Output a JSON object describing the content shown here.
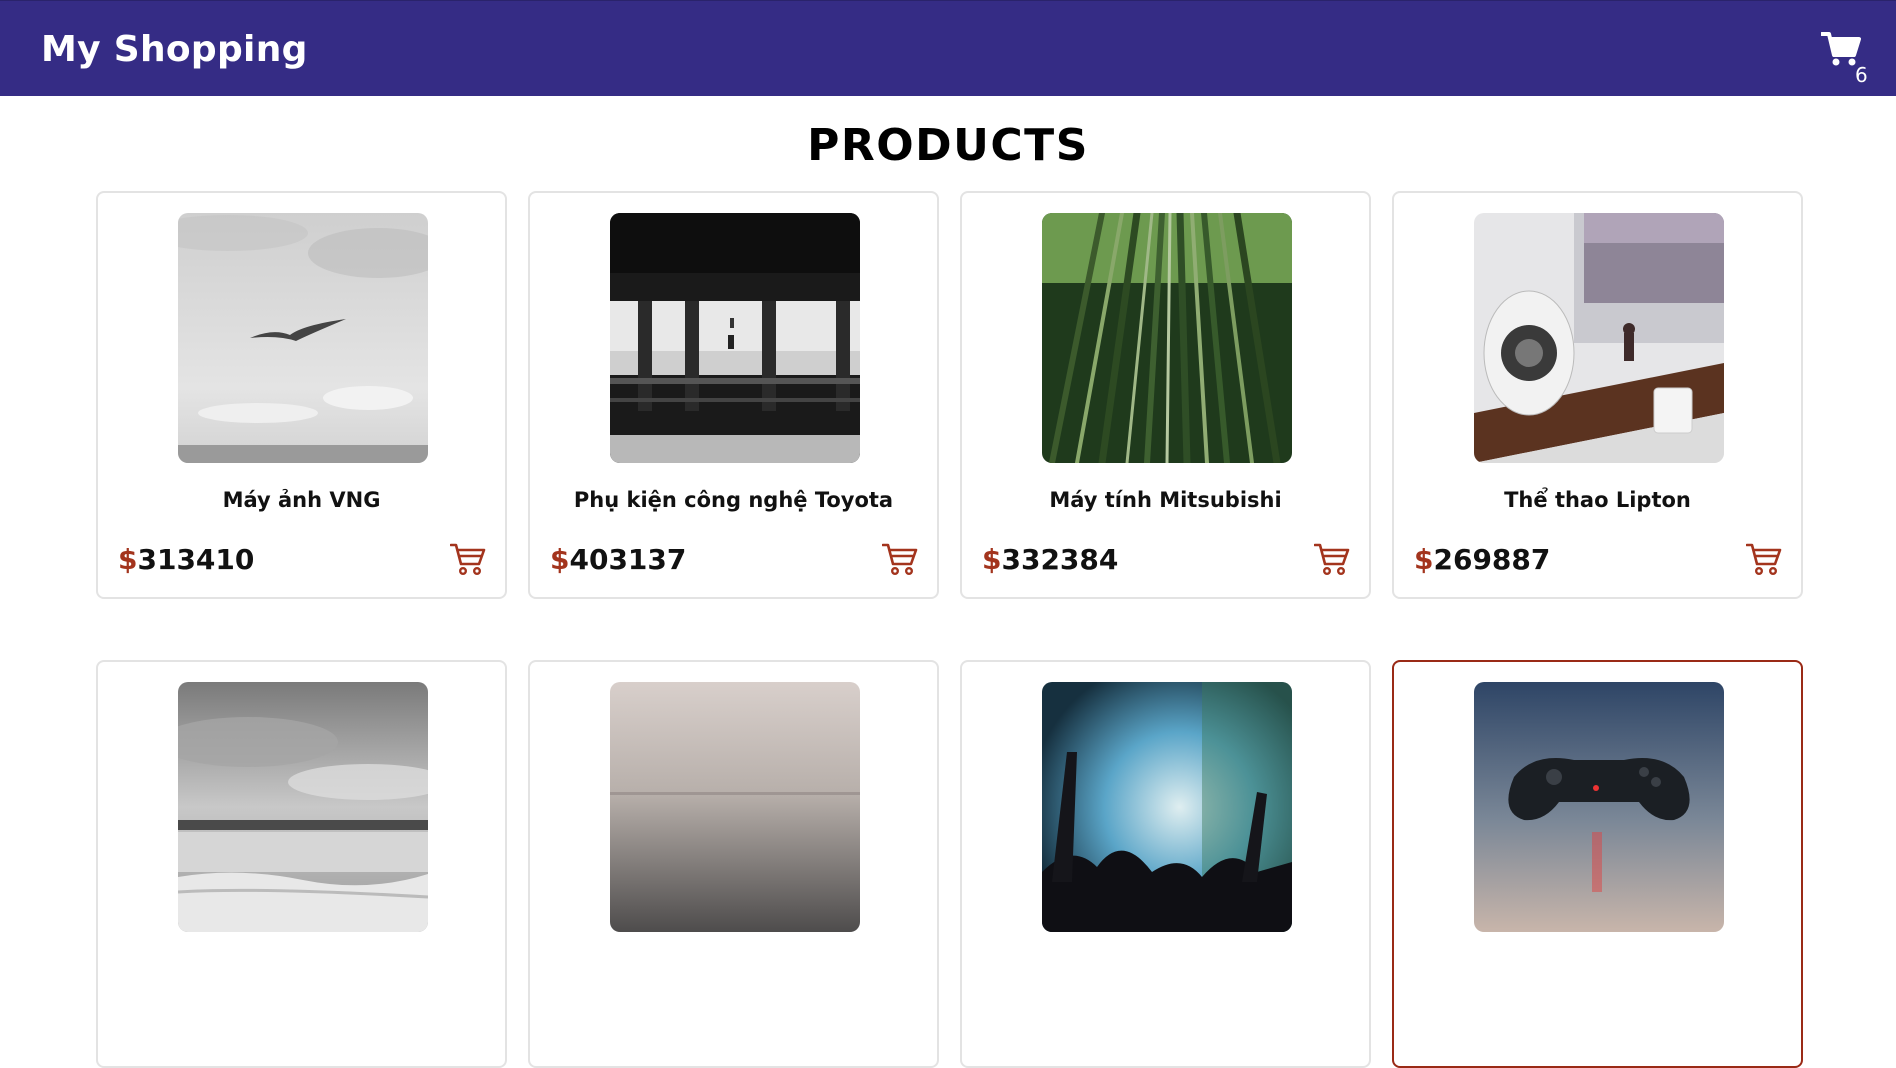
{
  "header": {
    "title": "My Shopping",
    "cart_icon": "cart-icon",
    "cart_count": "6",
    "background": "#352c85"
  },
  "main": {
    "title": "PRODUCTS"
  },
  "accent_color": "#a3341d",
  "products": [
    {
      "name": "Máy ảnh VNG",
      "currency": "$",
      "price": "313410",
      "image": "seagull-over-sea-bw"
    },
    {
      "name": "Phụ kiện công nghệ Toyota",
      "currency": "$",
      "price": "403137",
      "image": "subway-platform-bw"
    },
    {
      "name": "Máy tính Mitsubishi",
      "currency": "$",
      "price": "332384",
      "image": "bamboo-forest"
    },
    {
      "name": "Thể thao Lipton",
      "currency": "$",
      "price": "269887",
      "image": "desk-speaker"
    },
    {
      "name": "",
      "currency": "$",
      "price": "",
      "image": "beach-clouds-bw"
    },
    {
      "name": "",
      "currency": "$",
      "price": "",
      "image": "misty-sea"
    },
    {
      "name": "",
      "currency": "$",
      "price": "",
      "image": "concert-crowd"
    },
    {
      "name": "",
      "currency": "$",
      "price": "",
      "image": "game-controller"
    }
  ]
}
